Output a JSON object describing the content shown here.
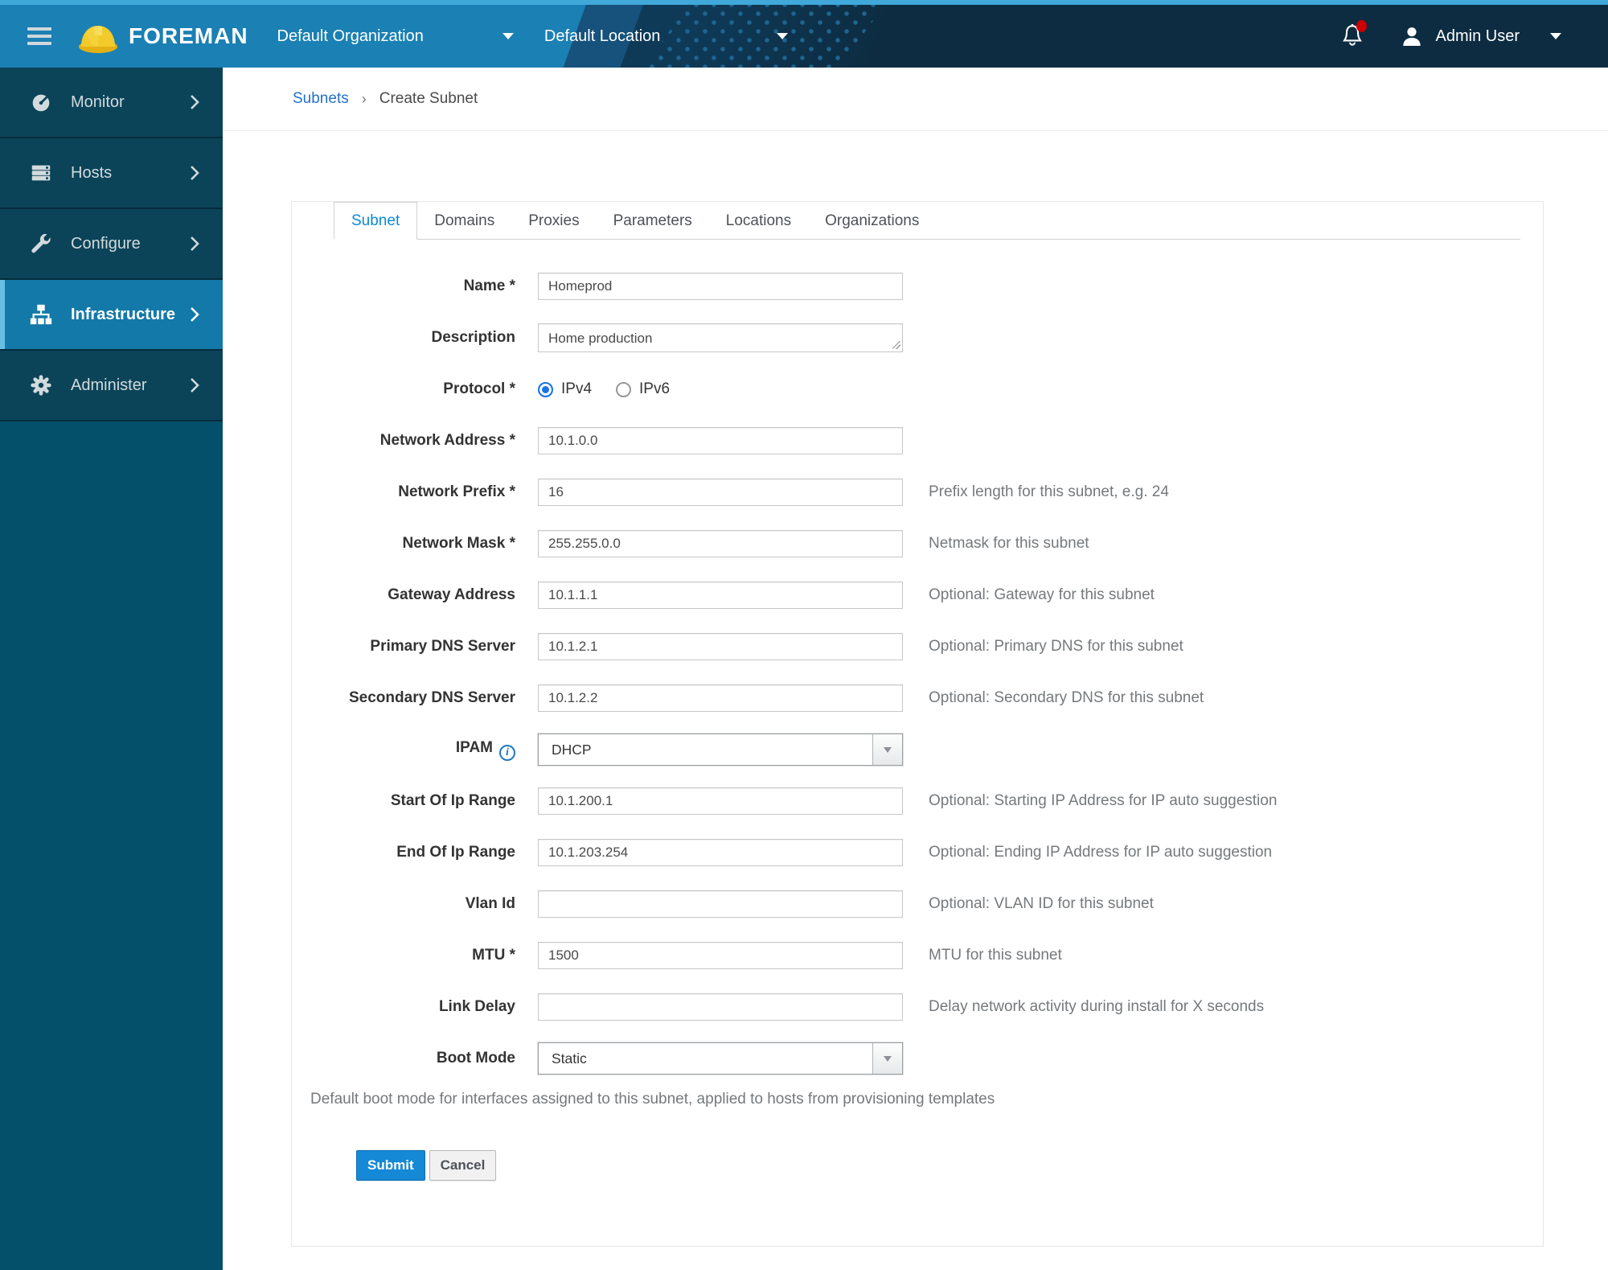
{
  "topbar": {
    "brand": "FOREMAN",
    "org_label": "Default Organization",
    "location_label": "Default Location",
    "user_label": "Admin User",
    "has_unread_notifications": true
  },
  "sidebar": {
    "items": [
      {
        "label": "Monitor",
        "icon": "gauge-icon",
        "active": false
      },
      {
        "label": "Hosts",
        "icon": "hosts-icon",
        "active": false
      },
      {
        "label": "Configure",
        "icon": "wrench-icon",
        "active": false
      },
      {
        "label": "Infrastructure",
        "icon": "infrastructure-icon",
        "active": true
      },
      {
        "label": "Administer",
        "icon": "gear-icon",
        "active": false
      }
    ]
  },
  "breadcrumb": {
    "separator": "›",
    "items": [
      {
        "label": "Subnets",
        "link": true
      },
      {
        "label": "Create Subnet",
        "link": false
      }
    ]
  },
  "tabs": [
    {
      "label": "Subnet",
      "active": true
    },
    {
      "label": "Domains",
      "active": false
    },
    {
      "label": "Proxies",
      "active": false
    },
    {
      "label": "Parameters",
      "active": false
    },
    {
      "label": "Locations",
      "active": false
    },
    {
      "label": "Organizations",
      "active": false
    }
  ],
  "form": {
    "rows": [
      {
        "label": "Name",
        "required": true,
        "type": "text",
        "value": "Homeprod"
      },
      {
        "label": "Description",
        "required": false,
        "type": "textarea",
        "value": "Home production"
      },
      {
        "label": "Protocol",
        "required": true,
        "type": "radio",
        "options": [
          {
            "label": "IPv4",
            "selected": true
          },
          {
            "label": "IPv6",
            "selected": false
          }
        ]
      },
      {
        "label": "Network Address",
        "required": true,
        "type": "text",
        "value": "10.1.0.0"
      },
      {
        "label": "Network Prefix",
        "required": true,
        "type": "text",
        "value": "16",
        "help": "Prefix length for this subnet, e.g. 24"
      },
      {
        "label": "Network Mask",
        "required": true,
        "type": "text",
        "value": "255.255.0.0",
        "help": "Netmask for this subnet"
      },
      {
        "label": "Gateway Address",
        "required": false,
        "type": "text",
        "value": "10.1.1.1",
        "help": "Optional: Gateway for this subnet"
      },
      {
        "label": "Primary DNS Server",
        "required": false,
        "type": "text",
        "value": "10.1.2.1",
        "help": "Optional: Primary DNS for this subnet"
      },
      {
        "label": "Secondary DNS Server",
        "required": false,
        "type": "text",
        "value": "10.1.2.2",
        "help": "Optional: Secondary DNS for this subnet"
      },
      {
        "label": "IPAM",
        "required": false,
        "info": true,
        "type": "select",
        "value": "DHCP"
      },
      {
        "label": "Start Of Ip Range",
        "required": false,
        "type": "text",
        "value": "10.1.200.1",
        "help": "Optional: Starting IP Address for IP auto suggestion"
      },
      {
        "label": "End Of Ip Range",
        "required": false,
        "type": "text",
        "value": "10.1.203.254",
        "help": "Optional: Ending IP Address for IP auto suggestion"
      },
      {
        "label": "Vlan Id",
        "required": false,
        "type": "text",
        "value": "",
        "help": "Optional: VLAN ID for this subnet"
      },
      {
        "label": "MTU",
        "required": true,
        "type": "text",
        "value": "1500",
        "help": "MTU for this subnet"
      },
      {
        "label": "Link Delay",
        "required": false,
        "type": "text",
        "value": "",
        "help": "Delay network activity during install for X seconds"
      },
      {
        "label": "Boot Mode",
        "required": false,
        "type": "select",
        "value": "Static"
      }
    ],
    "note": "Default boot mode for interfaces assigned to this subnet, applied to hosts from provisioning templates",
    "submit_label": "Submit",
    "cancel_label": "Cancel"
  },
  "colors": {
    "topbar_blue": "#1b80b4",
    "topbar_dark": "#0d2c41",
    "topbar_strip": "#41a8da",
    "sidebar_item": "#0b4459",
    "sidebar_active": "#1379a8",
    "sidebar_active_stripe": "#66c0e3",
    "tab_active_blue": "#0b8ad2",
    "link_blue": "#2470c8",
    "submit_blue": "#1589d6",
    "radio_blue": "#1a73e8",
    "badge_red": "#cc0000",
    "help_gray": "#75797c"
  }
}
